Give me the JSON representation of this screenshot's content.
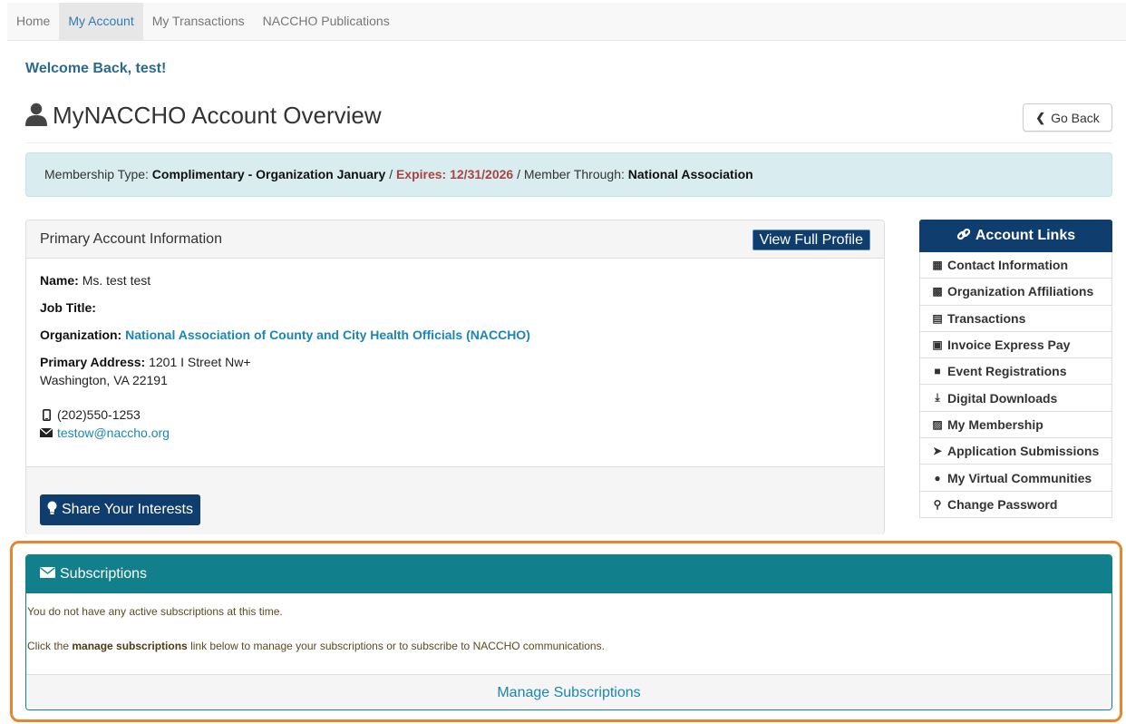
{
  "nav": {
    "items": [
      {
        "label": "Home"
      },
      {
        "label": "My Account"
      },
      {
        "label": "My Transactions"
      },
      {
        "label": "NACCHO Publications"
      }
    ]
  },
  "welcome": "Welcome Back, test!",
  "page_title": "MyNACCHO Account Overview",
  "go_back_label": "Go Back",
  "membership": {
    "type_label": "Membership Type:",
    "type_value": "Complimentary - Organization January",
    "sep1": "/",
    "expires": "Expires: 12/31/2026",
    "sep2": "/ Member Through:",
    "through_value": "National Association"
  },
  "primary": {
    "title": "Primary Account Information",
    "view_profile_label": "View Full Profile",
    "name_label": "Name:",
    "name_value": "Ms. test test",
    "job_label": "Job Title:",
    "org_label": "Organization:",
    "org_value": "National Association of County and City Health Officials (NACCHO)",
    "addr_label": "Primary Address:",
    "addr_line1": "1201 I Street Nw+",
    "addr_line2": "Washington, VA 22191",
    "phone": "(202)550-1253",
    "email": "testow@naccho.org",
    "share_label": "Share Your Interests"
  },
  "account_links": {
    "title": "Account Links",
    "items": [
      {
        "label": "Contact Information",
        "icon": "address-card-icon"
      },
      {
        "label": "Organization Affiliations",
        "icon": "building-icon"
      },
      {
        "label": "Transactions",
        "icon": "credit-card-icon"
      },
      {
        "label": "Invoice Express Pay",
        "icon": "cart-icon"
      },
      {
        "label": "Event Registrations",
        "icon": "calendar-icon"
      },
      {
        "label": "Digital Downloads",
        "icon": "download-icon"
      },
      {
        "label": "My Membership",
        "icon": "id-badge-icon"
      },
      {
        "label": "Application Submissions",
        "icon": "paper-plane-icon"
      },
      {
        "label": "My Virtual Communities",
        "icon": "users-icon"
      },
      {
        "label": "Change Password",
        "icon": "key-icon"
      }
    ]
  },
  "subscriptions": {
    "title": "Subscriptions",
    "line1": "You do not have any active subscriptions at this time.",
    "line2_pre": "Click the",
    "line2_bold": "manage subscriptions",
    "line2_post": "link below to manage your subscriptions or to subscribe to NACCHO communications.",
    "manage_label": "Manage Subscriptions"
  },
  "colors": {
    "navy": "#0f3d6e",
    "teal": "#12808c",
    "link": "#1a86b5",
    "expires": "#a94442",
    "highlight": "#e8862f"
  }
}
